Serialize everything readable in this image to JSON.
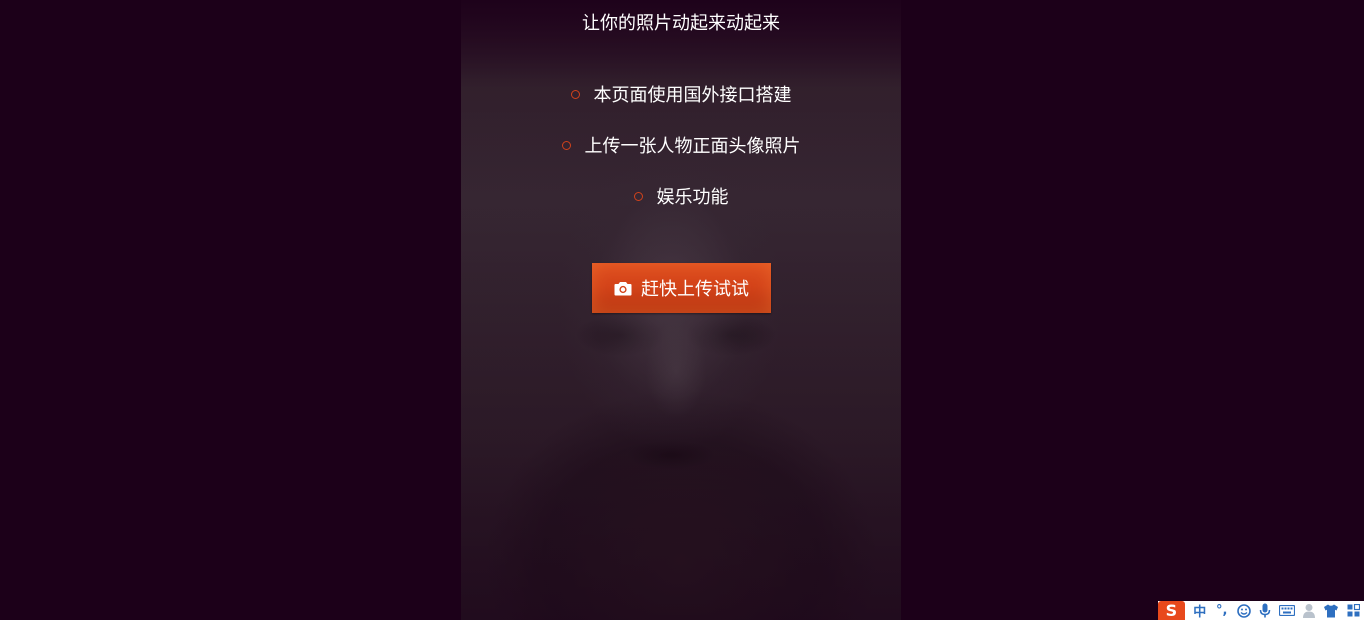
{
  "page": {
    "title": "让你的照片动起来动起来"
  },
  "features": [
    {
      "text": "本页面使用国外接口搭建"
    },
    {
      "text": "上传一张人物正面头像照片"
    },
    {
      "text": "娱乐功能"
    }
  ],
  "upload": {
    "label": "赶快上传试试",
    "icon": "camera-icon"
  },
  "ime": {
    "logo": "S",
    "mode": "中",
    "punct": "°,",
    "icons": [
      "emoji-icon",
      "microphone-icon",
      "keyboard-icon",
      "user-icon",
      "shirt-icon",
      "grid-icon"
    ]
  },
  "colors": {
    "background": "#1c0019",
    "accent": "#d4441a",
    "bullet": "#d0421c",
    "ime_blue": "#2e6fc0"
  }
}
